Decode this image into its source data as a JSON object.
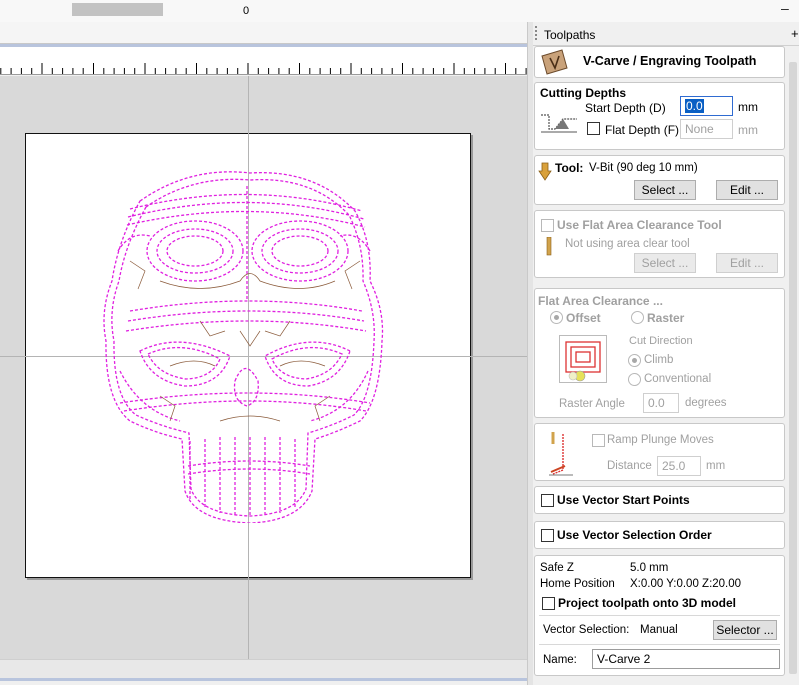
{
  "window": {
    "minimize_glyph": "–"
  },
  "view": {
    "ruler_zero": "0"
  },
  "panel": {
    "title": "Toolpaths",
    "pin_glyph": "+",
    "header": {
      "title": "V-Carve / Engraving Toolpath"
    },
    "cutting_depths": {
      "title": "Cutting Depths",
      "start_depth_label": "Start Depth (D)",
      "start_depth_value": "0.0",
      "start_depth_unit": "mm",
      "flat_depth_label": "Flat Depth (F)",
      "flat_depth_placeholder": "None",
      "flat_depth_unit": "mm"
    },
    "tool": {
      "label": "Tool:",
      "value": "V-Bit (90 deg 10 mm)",
      "select_button": "Select ...",
      "edit_button": "Edit ..."
    },
    "flat_area_tool": {
      "checkbox_label": "Use Flat Area Clearance Tool",
      "status": "Not using area clear tool",
      "select_button": "Select ...",
      "edit_button": "Edit ..."
    },
    "flat_area_clearance": {
      "title": "Flat Area Clearance ...",
      "offset_label": "Offset",
      "raster_label": "Raster",
      "cut_direction_label": "Cut Direction",
      "climb_label": "Climb",
      "conventional_label": "Conventional",
      "raster_angle_label": "Raster Angle",
      "raster_angle_value": "0.0",
      "raster_angle_unit": "degrees"
    },
    "ramp": {
      "checkbox_label": "Ramp Plunge Moves",
      "distance_label": "Distance",
      "distance_value": "25.0",
      "distance_unit": "mm"
    },
    "vector_start_points": {
      "label": "Use Vector Start Points"
    },
    "vector_selection_order": {
      "label": "Use Vector Selection Order"
    },
    "settings": {
      "safe_z_label": "Safe Z",
      "safe_z_value": "5.0 mm",
      "home_label": "Home Position",
      "home_value": "X:0.00 Y:0.00 Z:20.00",
      "project_label": "Project toolpath onto 3D model",
      "vector_selection_label": "Vector Selection:",
      "vector_selection_value": "Manual",
      "selector_button": "Selector ...",
      "name_label": "Name:",
      "name_value": "V-Carve 2"
    }
  },
  "colors": {
    "toolpath": "#e020e0",
    "vector": "#8a5a3a",
    "highlight": "#0a5fc4"
  }
}
